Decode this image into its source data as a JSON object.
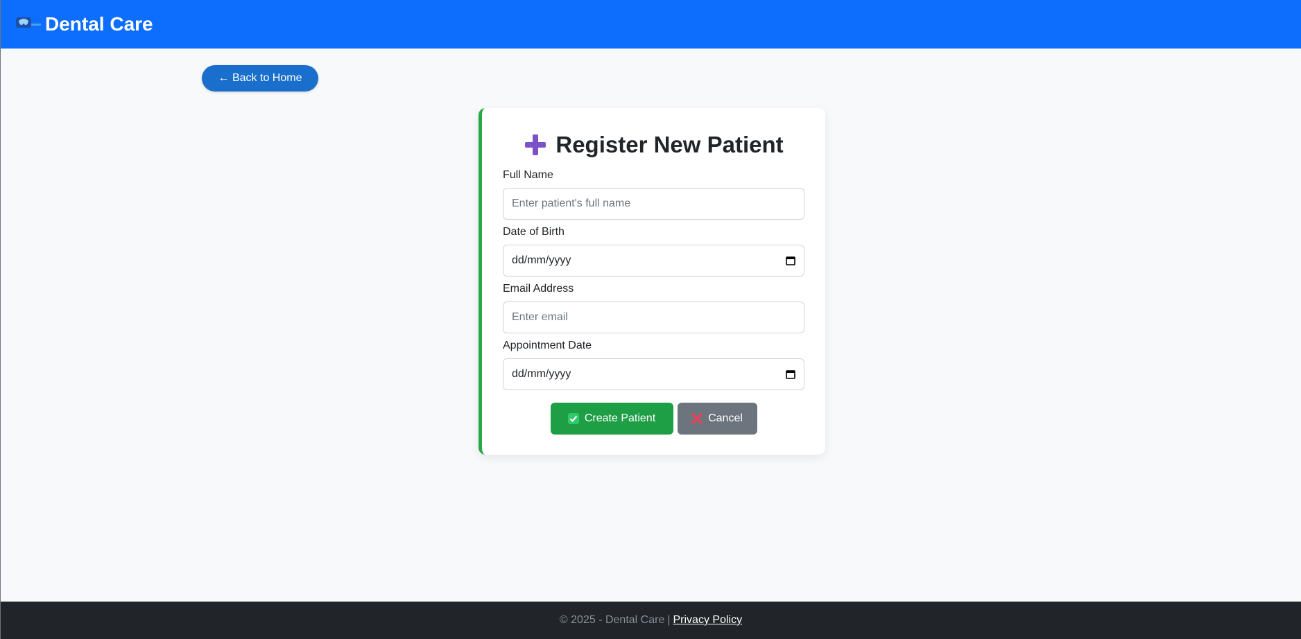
{
  "header": {
    "brand": "Dental Care",
    "logo_icon": "tooth-logo-icon",
    "bg_color": "#0d6efd"
  },
  "back_button": {
    "label": "← Back to Home"
  },
  "form": {
    "title": "Register New Patient",
    "title_icon": "plus-icon",
    "accent_color": "#28a745",
    "fields": [
      {
        "label": "Full Name",
        "type": "text",
        "placeholder": "Enter patient's full name",
        "value": ""
      },
      {
        "label": "Date of Birth",
        "type": "date",
        "value": "dd/mm/yyyy"
      },
      {
        "label": "Email Address",
        "type": "email",
        "placeholder": "Enter email",
        "value": ""
      },
      {
        "label": "Appointment Date",
        "type": "date",
        "value": "dd/mm/yyyy"
      }
    ],
    "submit_label": "Create Patient",
    "cancel_label": "Cancel"
  },
  "footer": {
    "copyright": "© 2025 - Dental Care",
    "separator": "|",
    "privacy_link": "Privacy Policy"
  }
}
